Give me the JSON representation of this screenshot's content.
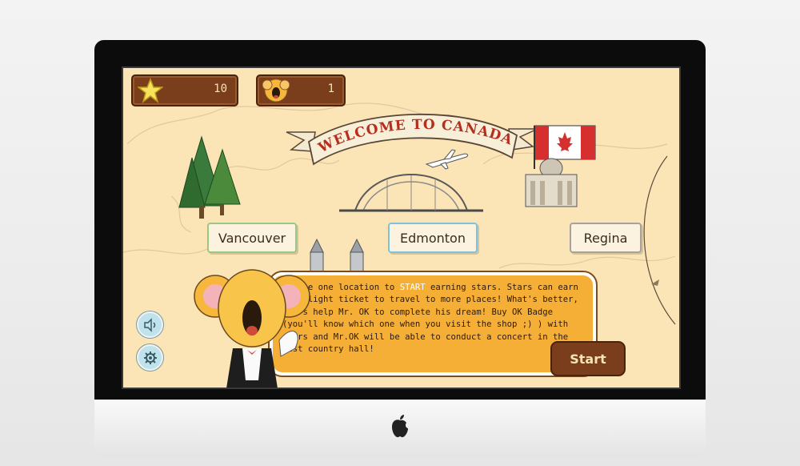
{
  "hud": {
    "stars_count": "10",
    "badges_count": "1"
  },
  "banner": {
    "title": "WELCOME TO CANADA"
  },
  "cities": [
    {
      "label": "Vancouver"
    },
    {
      "label": "Edmonton"
    },
    {
      "label": "Regina"
    }
  ],
  "message": {
    "part1": "Choose one location to ",
    "highlight": "START",
    "part2": " earning stars. Stars can earn you flight ticket to travel to more places! What's better, stars help Mr. OK to complete his dream! Buy OK Badge (you'll know which one when you visit the shop ;) ) with stars and Mr.OK will be able to conduct a concert in the best country hall!"
  },
  "buttons": {
    "start_label": "Start"
  },
  "icons": {
    "stars": "star-icon",
    "badge": "koala-badge-icon",
    "sound": "speaker-icon",
    "settings": "gear-icon",
    "apple": "apple-logo-icon"
  },
  "colors": {
    "background": "#fbe5b7",
    "panel": "#f6af36",
    "button": "#7a3e1c",
    "flag_red": "#d62f2f"
  }
}
